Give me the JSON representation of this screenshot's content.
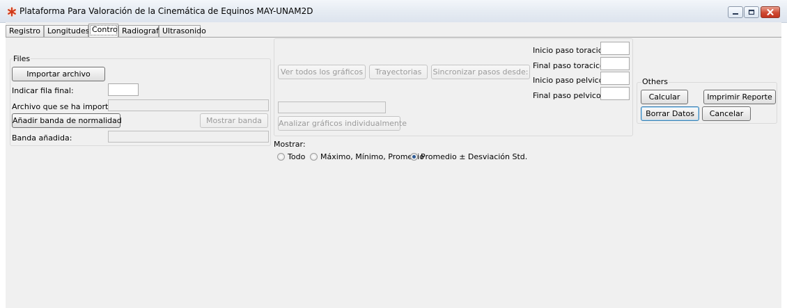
{
  "window": {
    "title": "Plataforma Para Valoración de la Cinemática de Equinos MAY-UNAM2D",
    "icon": "asterisk-app-icon",
    "controls": [
      "minimize-icon",
      "maximize-icon",
      "close-icon"
    ]
  },
  "tabs": [
    {
      "label": "Registro"
    },
    {
      "label": "Longitudes"
    },
    {
      "label": "Control"
    },
    {
      "label": "Radiografía"
    },
    {
      "label": "Ultrasonido"
    }
  ],
  "active_tab": "Control",
  "files": {
    "title": "Files",
    "import_button": "Importar archivo",
    "final_row_label": "Indicar fila final:",
    "final_row_value": "",
    "imported_file_label": "Archivo que se ha importado:",
    "imported_file_value": "",
    "add_band_button": "Añadir banda de normalidad",
    "show_band_button": "Mostrar banda",
    "band_added_label": "Banda añadida:",
    "band_added_value": ""
  },
  "graphs": {
    "view_all_button": "Ver todos los gráficos",
    "trajectories_button": "Trayectorias",
    "sync_button": "Sincronizar pasos desde:",
    "analyze_button": "Analizar gráficos individualmente",
    "sync_field_value": ""
  },
  "steps": {
    "inicio_toracico_label": "Inicio paso toracico:",
    "final_toracico_label": "Final paso toracico:",
    "inicio_pelvico_label": "Inicio paso pelvico:",
    "final_pelvico_label": "Final paso pelvico:",
    "inicio_toracico_value": "",
    "final_toracico_value": "",
    "inicio_pelvico_value": "",
    "final_pelvico_value": ""
  },
  "others": {
    "title": "Others",
    "calcular_button": "Calcular",
    "imprimir_button": "Imprimir Reporte",
    "borrar_button": "Borrar Datos",
    "cancelar_button": "Cancelar"
  },
  "mostrar": {
    "label": "Mostrar:",
    "options": [
      {
        "label": "Todo",
        "selected": false
      },
      {
        "label": "Máximo, Mínimo, Promedio",
        "selected": false
      },
      {
        "label": "Promedio ± Desviación Std.",
        "selected": true
      }
    ]
  }
}
